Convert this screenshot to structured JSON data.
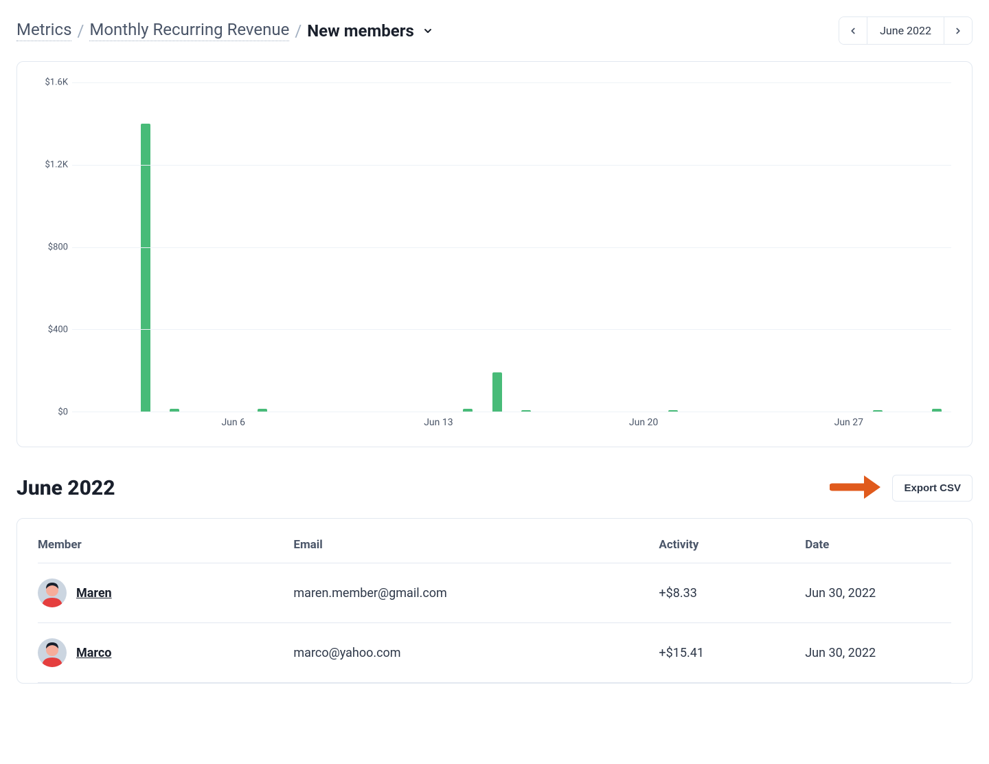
{
  "breadcrumb": {
    "root": "Metrics",
    "parent": "Monthly Recurring Revenue",
    "current": "New members"
  },
  "month_nav": {
    "label": "June 2022"
  },
  "chart_data": {
    "type": "bar",
    "title": "",
    "xlabel": "",
    "ylabel": "",
    "ylim": [
      0,
      1600
    ],
    "y_ticks": [
      "$0",
      "$400",
      "$800",
      "$1.2K",
      "$1.6K"
    ],
    "categories": [
      "Jun 1",
      "Jun 2",
      "Jun 3",
      "Jun 4",
      "Jun 5",
      "Jun 6",
      "Jun 7",
      "Jun 8",
      "Jun 9",
      "Jun 10",
      "Jun 11",
      "Jun 12",
      "Jun 13",
      "Jun 14",
      "Jun 15",
      "Jun 16",
      "Jun 17",
      "Jun 18",
      "Jun 19",
      "Jun 20",
      "Jun 21",
      "Jun 22",
      "Jun 23",
      "Jun 24",
      "Jun 25",
      "Jun 26",
      "Jun 27",
      "Jun 28",
      "Jun 29",
      "Jun 30"
    ],
    "values": [
      0,
      0,
      1400,
      15,
      0,
      0,
      15,
      0,
      0,
      0,
      0,
      0,
      0,
      15,
      190,
      8,
      0,
      0,
      0,
      0,
      8,
      0,
      0,
      0,
      0,
      0,
      0,
      8,
      0,
      15
    ],
    "x_tick_labels": [
      "Jun 6",
      "Jun 13",
      "Jun 20",
      "Jun 27"
    ],
    "x_tick_positions": [
      6,
      13,
      20,
      27
    ]
  },
  "section": {
    "title": "June 2022",
    "export_label": "Export CSV"
  },
  "table": {
    "columns": {
      "member": "Member",
      "email": "Email",
      "activity": "Activity",
      "date": "Date"
    },
    "rows": [
      {
        "name": "Maren",
        "email": "maren.member@gmail.com",
        "activity": "+$8.33",
        "date": "Jun 30, 2022",
        "avatar_hair": "#1a202c",
        "avatar_body": "#e53e3e",
        "avatar_face": "#f6ad9b"
      },
      {
        "name": "Marco",
        "email": "marco@yahoo.com",
        "activity": "+$15.41",
        "date": "Jun 30, 2022",
        "avatar_hair": "#1a202c",
        "avatar_body": "#e53e3e",
        "avatar_face": "#f6ad9b"
      }
    ]
  },
  "colors": {
    "bar": "#48bb78",
    "arrow": "#e05a1c"
  }
}
